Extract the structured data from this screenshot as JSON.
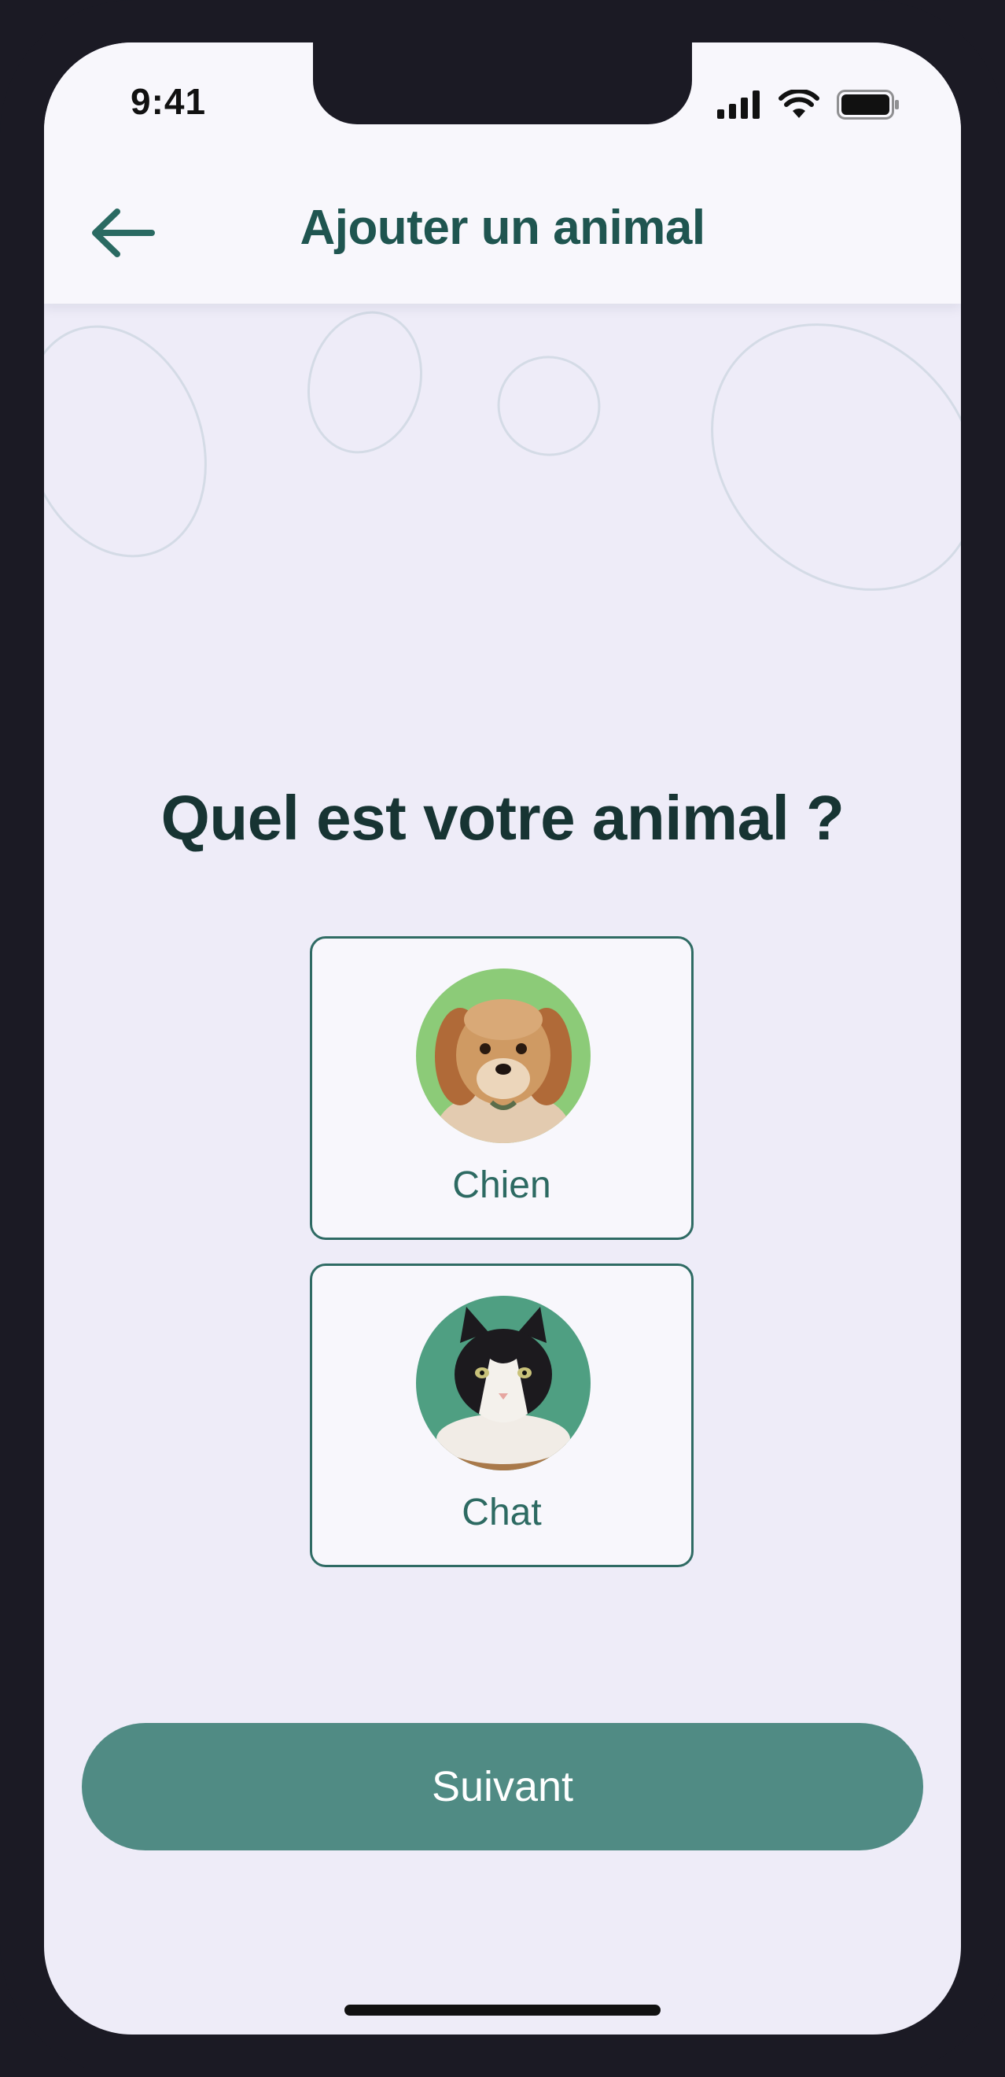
{
  "status_bar": {
    "time": "9:41",
    "icons": [
      "cellular-signal-icon",
      "wifi-icon",
      "battery-icon"
    ]
  },
  "header": {
    "back_icon": "arrow-left-icon",
    "title": "Ajouter un animal"
  },
  "main": {
    "question": "Quel est votre animal ?",
    "options": [
      {
        "label": "Chien",
        "image": "dog-photo"
      },
      {
        "label": "Chat",
        "image": "cat-photo"
      }
    ]
  },
  "footer": {
    "next_label": "Suivant"
  },
  "colors": {
    "accent": "#508b84",
    "title": "#1f5550",
    "background": "#eeecf8",
    "card_border": "#2f6b64"
  }
}
